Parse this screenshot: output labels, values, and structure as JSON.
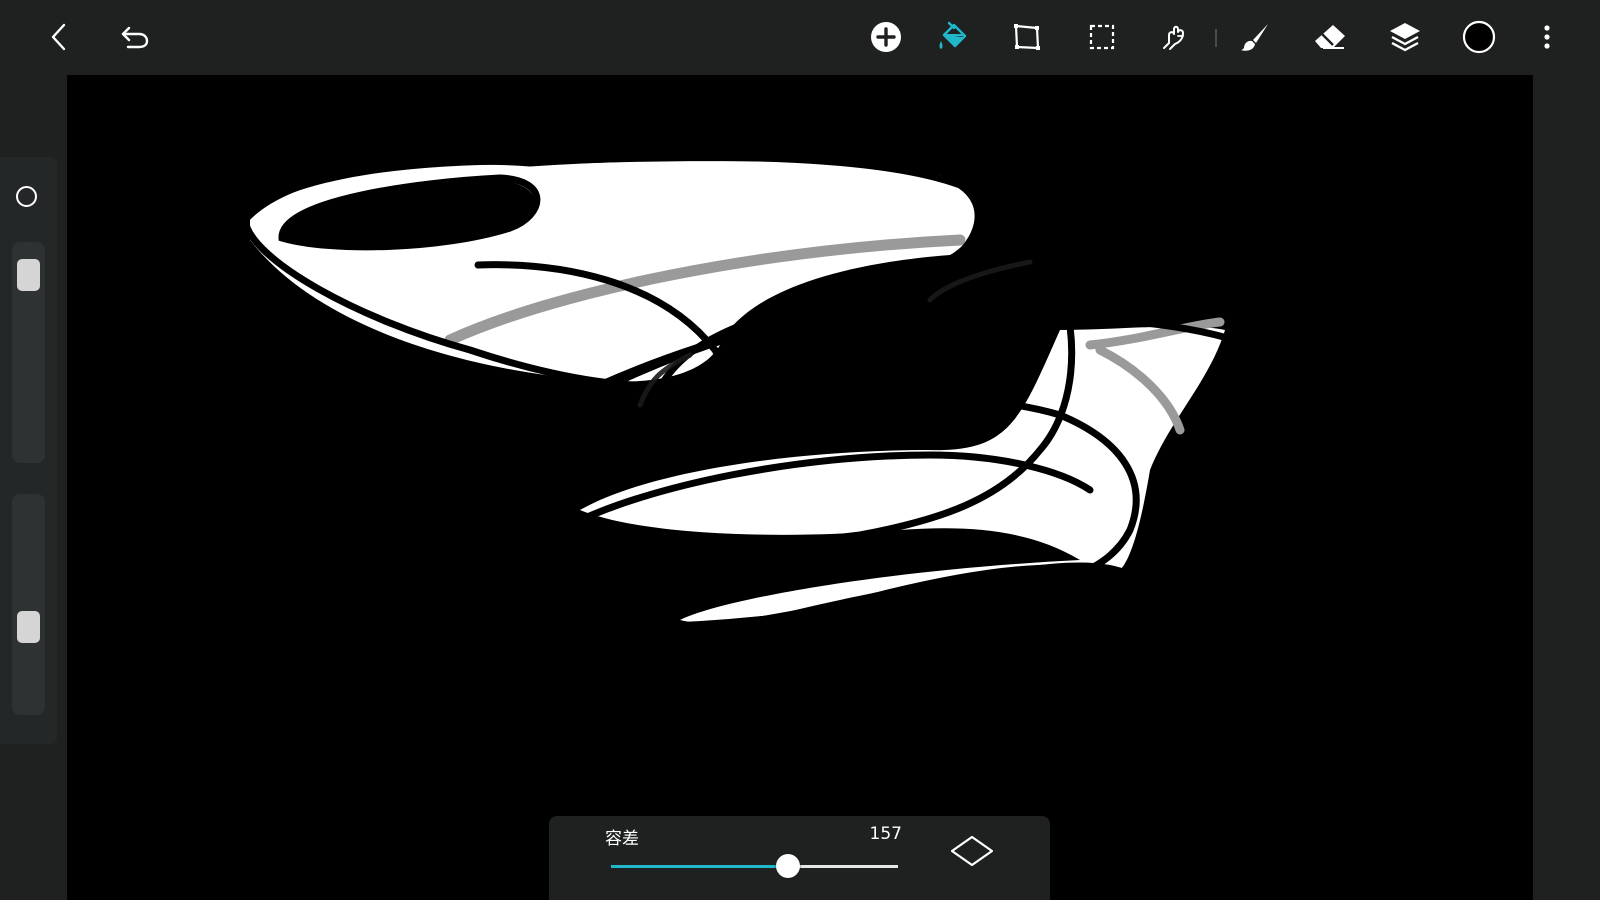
{
  "app": {
    "accent_color": "#1fb7c9",
    "background_color": "#1f2121",
    "canvas_color": "#000000"
  },
  "toolbar": {
    "left_buttons": [
      {
        "name": "back-button",
        "icon": "chevron-left-icon"
      },
      {
        "name": "undo-button",
        "icon": "undo-icon"
      }
    ],
    "tools": [
      {
        "name": "add-button",
        "icon": "plus-circle-icon",
        "active": false
      },
      {
        "name": "fill-tool-button",
        "icon": "paint-bucket-icon",
        "active": true
      },
      {
        "name": "transform-tool-button",
        "icon": "transform-icon",
        "active": false
      },
      {
        "name": "selection-tool-button",
        "icon": "dashed-rectangle-icon",
        "active": false
      },
      {
        "name": "smudge-tool-button",
        "icon": "finger-smudge-icon",
        "active": false
      },
      {
        "name": "brush-tool-button",
        "icon": "brush-icon",
        "active": false
      },
      {
        "name": "eraser-tool-button",
        "icon": "eraser-icon",
        "active": false
      },
      {
        "name": "layers-button",
        "icon": "layers-icon",
        "active": false
      },
      {
        "name": "color-picker-button",
        "icon": "color-swatch-icon",
        "active": false,
        "color": "#000000"
      },
      {
        "name": "more-menu-button",
        "icon": "more-vertical-icon",
        "active": false
      }
    ]
  },
  "side_panel": {
    "shape_icon": "circle-outline-icon",
    "size_slider_level": 0.05,
    "opacity_slider_level": 0.63
  },
  "fill_options": {
    "tolerance_label": "容差",
    "tolerance_value": "157",
    "tolerance_min": 0,
    "tolerance_max": 255,
    "tolerance_level": 157,
    "mode_icon": "diamond-outline-icon"
  }
}
